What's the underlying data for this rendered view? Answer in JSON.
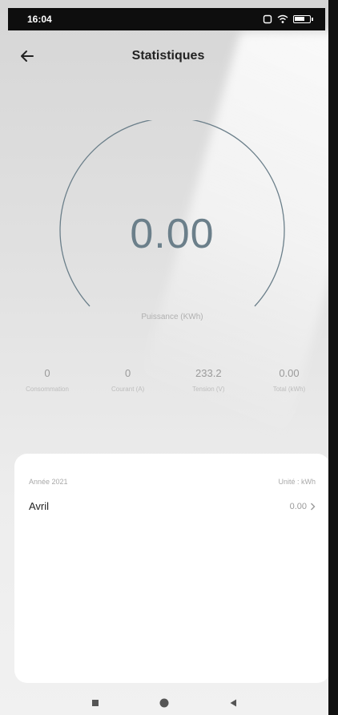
{
  "status_bar": {
    "time": "16:04"
  },
  "header": {
    "title": "Statistiques"
  },
  "gauge": {
    "value": "0.00",
    "label": "Puissance (KWh)"
  },
  "stats": [
    {
      "value": "0",
      "label": "Consommation"
    },
    {
      "value": "0",
      "label": "Courant (A)"
    },
    {
      "value": "233.2",
      "label": "Tension (V)"
    },
    {
      "value": "0.00",
      "label": "Total (kWh)"
    }
  ],
  "card": {
    "year_label": "Année 2021",
    "unit_label": "Unité : kWh",
    "rows": [
      {
        "month": "Avril",
        "value": "0.00"
      }
    ]
  },
  "colors": {
    "gauge_stroke": "#6b7f8a",
    "status_bar": "#0e0e0e",
    "card_bg": "#ffffff"
  },
  "icons": {
    "back": "arrow-left-icon",
    "chevron": "chevron-right-icon",
    "nav_recent": "square-icon",
    "nav_home": "circle-icon",
    "nav_back": "triangle-back-icon"
  }
}
